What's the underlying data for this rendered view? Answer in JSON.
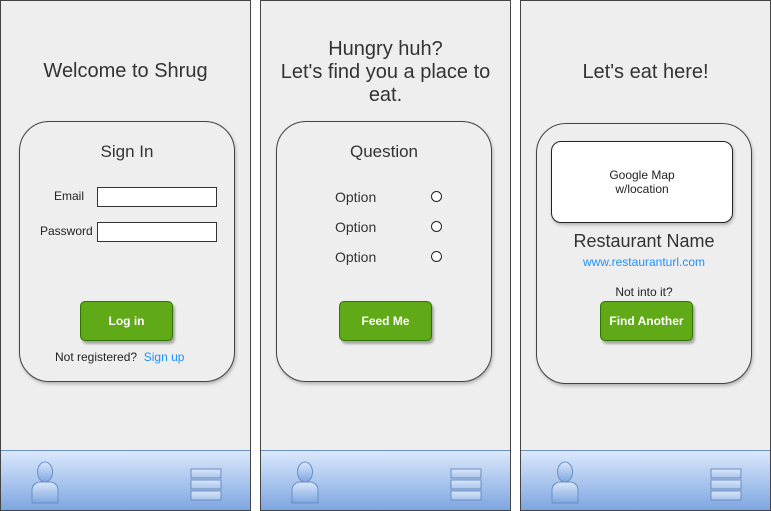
{
  "screens": [
    {
      "title": "Welcome to Shrug",
      "card": {
        "heading": "Sign In",
        "email_label": "Email",
        "email_value": "",
        "password_label": "Password",
        "password_value": "",
        "login_button": "Log in",
        "register_prompt": "Not registered?",
        "signup_link": "Sign up"
      }
    },
    {
      "title_lines": [
        "Hungry huh?",
        "Let's find you a place to",
        "eat."
      ],
      "card": {
        "heading": "Question",
        "options": [
          "Option",
          "Option",
          "Option"
        ],
        "feed_button": "Feed Me"
      }
    },
    {
      "title": "Let's eat here!",
      "card": {
        "map_lines": [
          "Google Map",
          "w/location"
        ],
        "restaurant_name": "Restaurant Name",
        "restaurant_url": "www.restauranturl.com",
        "not_into_it": "Not into it?",
        "find_another_button": "Find Another"
      }
    }
  ],
  "tabbar": {
    "left_icon": "user-icon",
    "right_icon": "menu-icon"
  },
  "colors": {
    "screen_bg": "#eeeeee",
    "button_green": "#60a917",
    "link_blue": "#1e90ff",
    "tabbar_top": "#dae8fc",
    "tabbar_bottom": "#7ea6e0"
  }
}
